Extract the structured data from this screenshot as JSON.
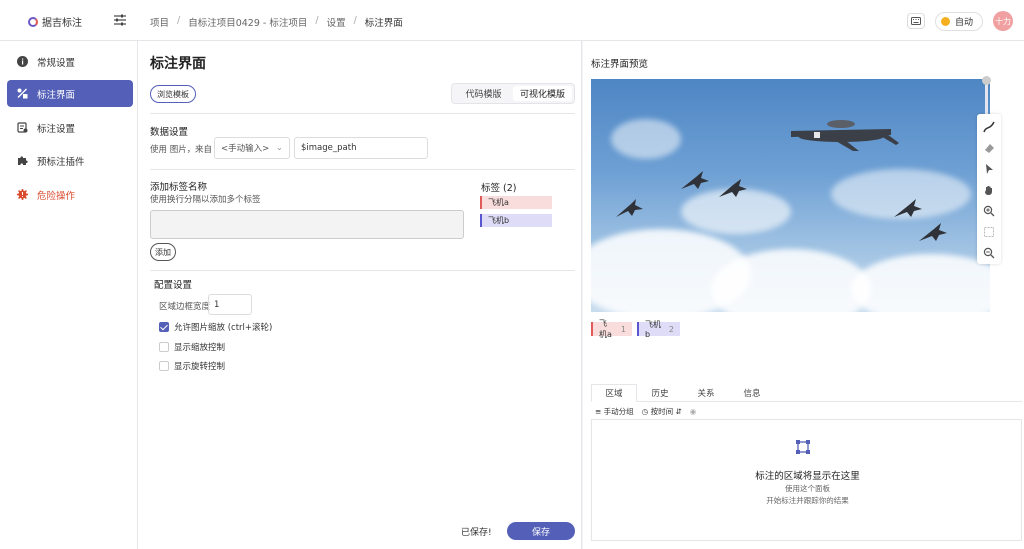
{
  "header": {
    "brand": "据吉标注",
    "breadcrumb": [
      "项目",
      "自标注项目0429 - 标注项目",
      "设置",
      "标注界面"
    ],
    "auto_label": "自动",
    "avatar_text": "十力"
  },
  "sidebar": {
    "items": [
      {
        "label": "常规设置",
        "icon": "info-icon"
      },
      {
        "label": "标注界面",
        "icon": "layout-icon"
      },
      {
        "label": "标注设置",
        "icon": "form-icon"
      },
      {
        "label": "预标注插件",
        "icon": "puzzle-icon"
      },
      {
        "label": "危险操作",
        "icon": "danger-gear-icon"
      }
    ],
    "active_index": 1,
    "accent": "#5460b8",
    "danger_color": "#d94a2e"
  },
  "main": {
    "title": "标注界面",
    "template_button": "浏览模板",
    "mode_tabs": [
      "代码模版",
      "可视化模版"
    ],
    "active_mode": "可视化模版",
    "data_settings": {
      "title": "数据设置",
      "use_label": "使用 图片，",
      "from_label": "来自",
      "select_value": "<手动输入>",
      "input_value": "$image_path"
    },
    "tag_names": {
      "title": "添加标签名称",
      "hint": "使用换行分隔以添加多个标签",
      "add_button": "添加"
    },
    "tags": {
      "title": "标签 (2)",
      "items": [
        "飞机a",
        "飞机b"
      ]
    },
    "config": {
      "title": "配置设置",
      "border_width_label": "区域边框宽度",
      "border_width_value": "1",
      "checks": [
        {
          "label": "允许图片缩放 (ctrl+滚轮)",
          "checked": true
        },
        {
          "label": "显示缩放控制",
          "checked": false
        },
        {
          "label": "显示旋转控制",
          "checked": false
        }
      ]
    },
    "saved_text": "已保存!",
    "save_button": "保存"
  },
  "preview": {
    "title": "标注界面预览",
    "tags": [
      {
        "label": "飞机a",
        "count": "1"
      },
      {
        "label": "飞机b",
        "count": "2"
      }
    ],
    "tabs": [
      "区域",
      "历史",
      "关系",
      "信息"
    ],
    "active_tab": "区域",
    "tools": [
      "手动分组",
      "按时间"
    ],
    "empty_title": "标注的区域将显示在这里",
    "empty_line1": "使用这个面板",
    "empty_line2": "开始标注并跟踪你的结果"
  }
}
